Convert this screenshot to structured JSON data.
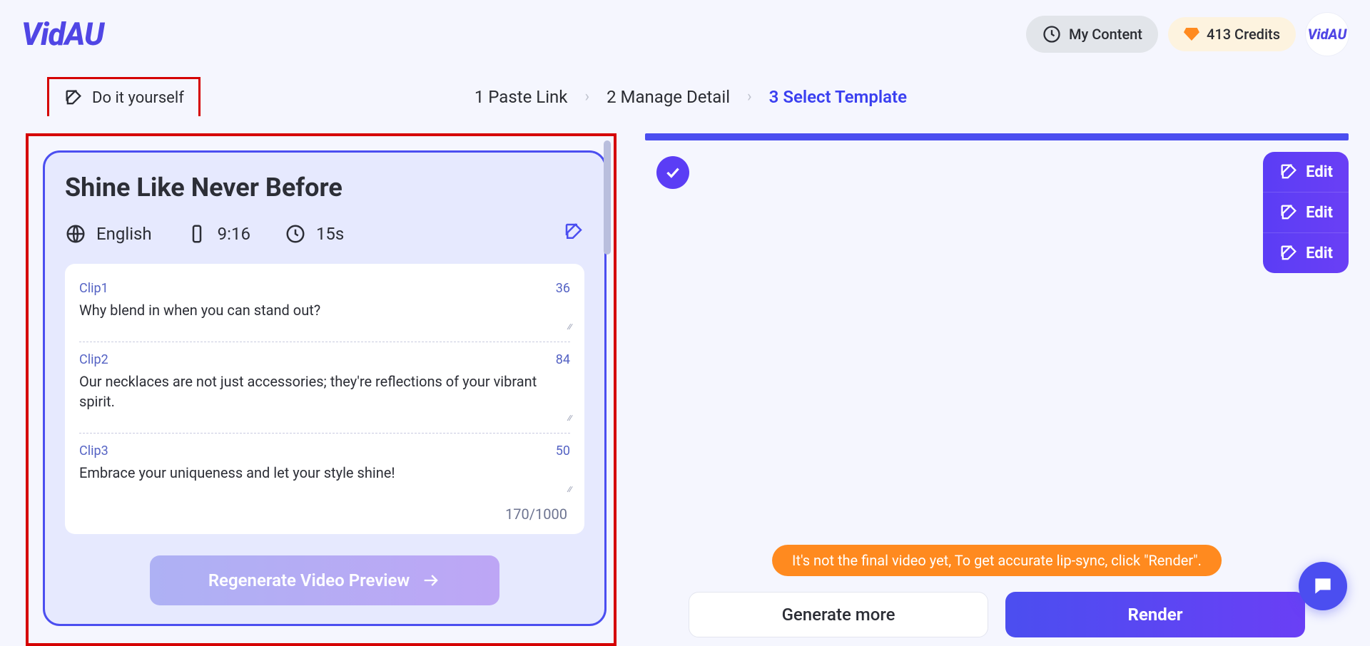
{
  "brand": "VidAU",
  "header": {
    "my_content": "My Content",
    "credits": "413 Credits"
  },
  "diy_tab": "Do it yourself",
  "steps": {
    "s1": "1 Paste Link",
    "s2": "2 Manage Detail",
    "s3": "3 Select Template"
  },
  "card": {
    "title": "Shine Like Never Before",
    "language": "English",
    "aspect": "9:16",
    "duration": "15s",
    "char_total": "170/1000",
    "regenerate": "Regenerate Video Preview",
    "clips": [
      {
        "label": "Clip1",
        "count": "36",
        "text": "Why blend in when you can stand out?"
      },
      {
        "label": "Clip2",
        "count": "84",
        "text": " Our necklaces are not just accessories; they're reflections of your vibrant spirit."
      },
      {
        "label": "Clip3",
        "count": "50",
        "text": " Embrace your uniqueness and let your style shine!"
      }
    ]
  },
  "right": {
    "edit": "Edit",
    "hint": "It's not the final video yet, To get accurate lip-sync, click \"Render\".",
    "generate_more": "Generate more",
    "render": "Render"
  }
}
